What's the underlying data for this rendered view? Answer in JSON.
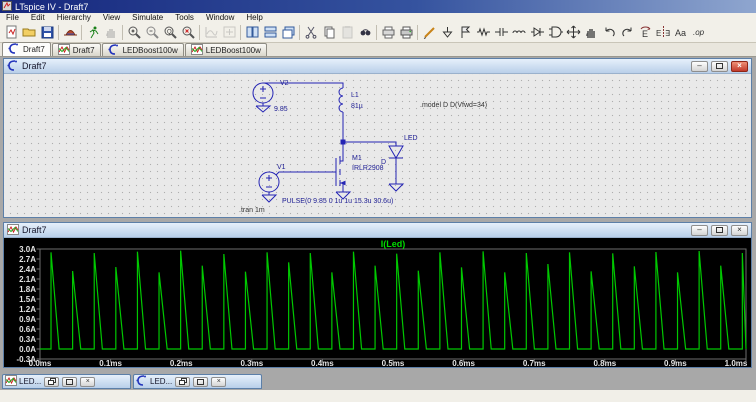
{
  "titlebar": {
    "title": "LTspice IV - Draft7"
  },
  "menu": {
    "items": [
      "File",
      "Edit",
      "Hierarchy",
      "View",
      "Simulate",
      "Tools",
      "Window",
      "Help"
    ]
  },
  "toolbar": {
    "icons": [
      "new-schematic",
      "open",
      "save",
      "control-panel",
      "run",
      "halt",
      "zoom-in",
      "zoom-back",
      "zoom-fit",
      "zoom-extents",
      "autorange",
      "pan",
      "tile-vertical",
      "tile-horizontal",
      "cascade",
      "cut",
      "copy",
      "paste",
      "find",
      "print-setup",
      "print",
      "wire",
      "ground",
      "label-net",
      "resistor",
      "capacitor",
      "inductor",
      "diode",
      "component",
      "move",
      "drag",
      "undo",
      "redo",
      "rotate",
      "mirror",
      "text",
      "spice-directive"
    ],
    "grayed": [
      "halt",
      "autorange",
      "pan",
      "paste"
    ]
  },
  "tabs": [
    {
      "label": "Draft7",
      "icon": "schematic",
      "selected": true
    },
    {
      "label": "Draft7",
      "icon": "waveform",
      "selected": false
    },
    {
      "label": "LEDBoost100w",
      "icon": "schematic",
      "selected": false
    },
    {
      "label": "LEDBoost100w",
      "icon": "waveform",
      "selected": false
    }
  ],
  "schematic": {
    "window_title": "Draft7",
    "labels": {
      "v2_name": "V2",
      "v2_value": "9.85",
      "l1_name": "L1",
      "l1_value": "81µ",
      "m1_name": "M1",
      "m1_model": "IRLR2908",
      "led_model": "LED",
      "led_name": "D",
      "v1_name": "V1",
      "v1_value": "PULSE(0 9.85 0 1u 1u 15.3u 30.6u)",
      "tran_directive": ".tran 1m",
      "model_directive": ".model D D(Vfwd=34)"
    },
    "ink_color": "#2424b4"
  },
  "plot": {
    "window_title": "Draft7"
  },
  "chart_data": {
    "type": "line",
    "title": "I(Led)",
    "x_ticks": [
      "0.0ms",
      "0.1ms",
      "0.2ms",
      "0.3ms",
      "0.4ms",
      "0.5ms",
      "0.6ms",
      "0.7ms",
      "0.8ms",
      "0.9ms",
      "1.0ms"
    ],
    "y_ticks": [
      "3.0A",
      "2.7A",
      "2.4A",
      "2.1A",
      "1.8A",
      "1.5A",
      "1.2A",
      "0.9A",
      "0.6A",
      "0.3A",
      "0.0A",
      "-0.3A"
    ],
    "xlim_us": [
      0,
      1000
    ],
    "ylim": [
      -0.3,
      3.0
    ],
    "background": "#000000",
    "trace_color": "#00c800",
    "grid": false,
    "legend_position": "top-center",
    "series": [
      {
        "name": "I(Led)",
        "waveform": "periodic-spikes-dcm",
        "baseline": 0,
        "first_spike_us": 15.6,
        "period_us": 30.6,
        "decay_us": 11.5,
        "peaks": [
          2.9,
          2.34,
          2.88,
          2.46,
          2.92,
          2.3,
          2.95,
          2.5,
          2.85,
          2.32,
          2.9,
          2.6,
          2.88,
          2.3,
          2.92,
          2.5,
          2.86,
          2.35,
          2.9,
          2.45,
          2.93,
          2.3,
          2.88,
          2.55,
          2.9,
          2.33,
          2.87,
          2.48,
          2.91,
          2.3,
          2.94,
          2.5,
          2.88
        ]
      }
    ]
  },
  "minimized_windows": [
    {
      "label": "LED...",
      "icon": "waveform"
    },
    {
      "label": "LED...",
      "icon": "schematic"
    }
  ]
}
